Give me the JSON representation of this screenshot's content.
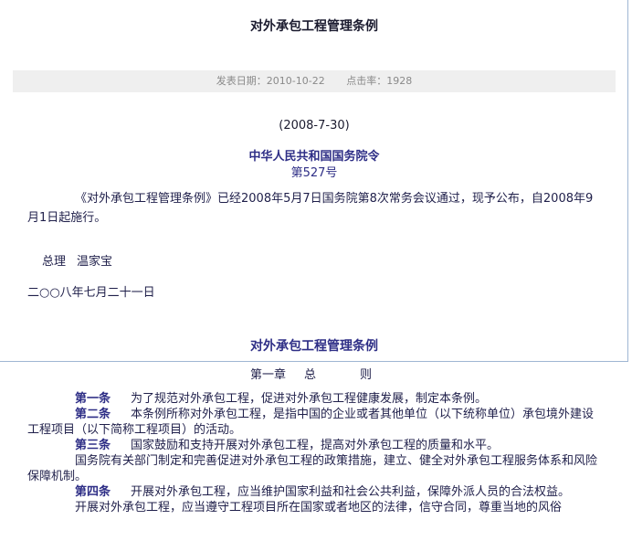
{
  "page": {
    "title": "对外承包工程管理条例",
    "publish_date": "发表日期：2010-10-22",
    "click_rate": "点击率：1928"
  },
  "decree": {
    "date_paren": "(2008-7-30)",
    "title": "中华人民共和国国务院令",
    "number": "第527号",
    "announcement": "《对外承包工程管理条例》已经2008年5月7日国务院第8次常务会议通过，现予公布，自2008年9月1日起施行。",
    "premier_title": "总理",
    "premier_name": "温家宝",
    "sign_date": "二○○八年七月二十一日"
  },
  "regulation": {
    "title": "对外承包工程管理条例",
    "chapter_no": "第一章",
    "chapter_name_1": "总",
    "chapter_name_2": "则",
    "articles": [
      {
        "no": "第一条",
        "text": "为了规范对外承包工程，促进对外承包工程健康发展，制定本条例。"
      },
      {
        "no": "第二条",
        "text": "本条例所称对外承包工程，是指中国的企业或者其他单位（以下统称单位）承包境外建设工程项目（以下简称工程项目）的活动。"
      },
      {
        "no": "第三条",
        "text": "国家鼓励和支持开展对外承包工程，提高对外承包工程的质量和水平。"
      },
      {
        "no": "",
        "text": "国务院有关部门制定和完善促进对外承包工程的政策措施，建立、健全对外承包工程服务体系和风险保障机制。"
      },
      {
        "no": "第四条",
        "text": "开展对外承包工程，应当维护国家利益和社会公共利益，保障外派人员的合法权益。"
      },
      {
        "no": "",
        "text": "开展对外承包工程，应当遵守工程项目所在国家或者地区的法律，信守合同，尊重当地的风俗"
      }
    ]
  }
}
